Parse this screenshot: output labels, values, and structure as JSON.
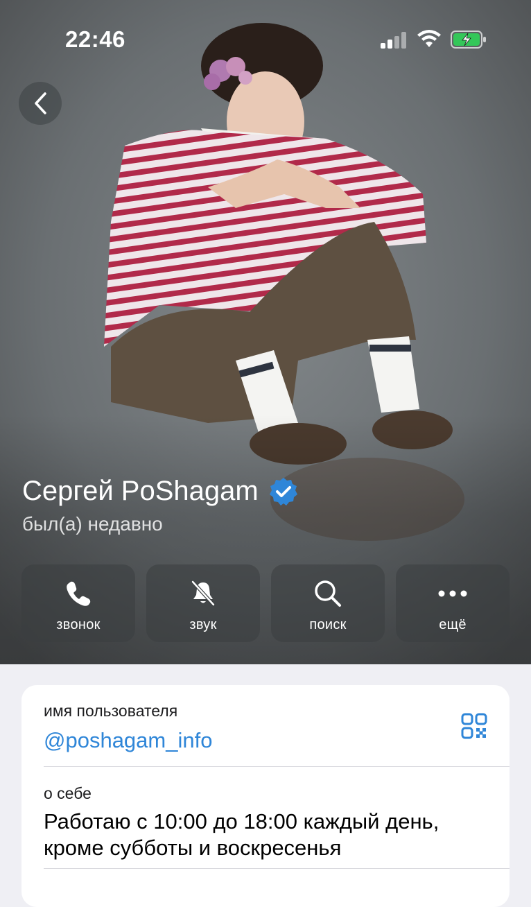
{
  "status_bar": {
    "time": "22:46"
  },
  "profile": {
    "name": "Сергей PoShagam",
    "last_seen": "был(а) недавно",
    "verified": true
  },
  "actions": [
    {
      "icon": "phone-icon",
      "label": "звонок"
    },
    {
      "icon": "bell-off-icon",
      "label": "звук"
    },
    {
      "icon": "search-icon",
      "label": "поиск"
    },
    {
      "icon": "more-icon",
      "label": "ещё"
    }
  ],
  "info": {
    "username_label": "имя пользователя",
    "username_value": "@poshagam_info",
    "about_label": "о себе",
    "about_value": "Работаю с 10:00 до 18:00 каждый день, кроме субботы и воскресенья"
  },
  "colors": {
    "accent": "#2f86d8",
    "verified_badge": "#2f86d8",
    "battery_fill": "#34c759"
  },
  "icons": {
    "back": "chevron-left-icon",
    "qr": "qr-code-icon",
    "verified": "verified-badge-icon"
  }
}
